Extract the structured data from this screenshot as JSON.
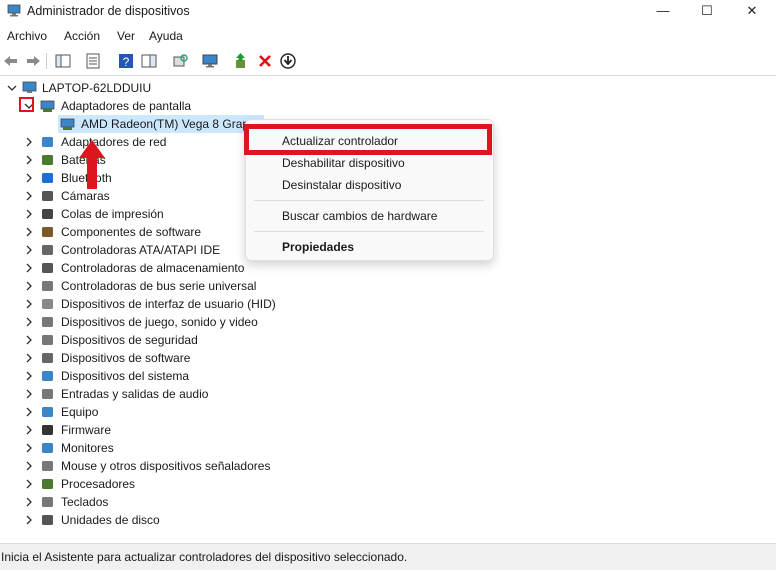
{
  "window": {
    "title": "Administrador de dispositivos",
    "minimize": "—",
    "maximize": "☐",
    "close": "✕"
  },
  "menu": [
    "Archivo",
    "Acción",
    "Ver",
    "Ayuda"
  ],
  "tree": {
    "computer": "LAPTOP-62LDDUIU",
    "expanded_category": "Adaptadores de pantalla",
    "selected_device": "AMD Radeon(TM) Vega 8 Graphics",
    "categories": [
      "Adaptadores de red",
      "Baterías",
      "Bluetooth",
      "Cámaras",
      "Colas de impresión",
      "Componentes de software",
      "Controladoras ATA/ATAPI IDE",
      "Controladoras de almacenamiento",
      "Controladoras de bus serie universal",
      "Dispositivos de interfaz de usuario (HID)",
      "Dispositivos de juego, sonido y video",
      "Dispositivos de seguridad",
      "Dispositivos de software",
      "Dispositivos del sistema",
      "Entradas y salidas de audio",
      "Equipo",
      "Firmware",
      "Monitores",
      "Mouse y otros dispositivos señaladores",
      "Procesadores",
      "Teclados",
      "Unidades de disco"
    ]
  },
  "context_menu": {
    "update": "Actualizar controlador",
    "disable": "Deshabilitar dispositivo",
    "uninstall": "Desinstalar dispositivo",
    "scan": "Buscar cambios de hardware",
    "properties": "Propiedades"
  },
  "status": "Inicia el Asistente para actualizar controladores del dispositivo seleccionado.",
  "colors": {
    "annotation": "#e0141e",
    "selection": "#cce8ff"
  }
}
